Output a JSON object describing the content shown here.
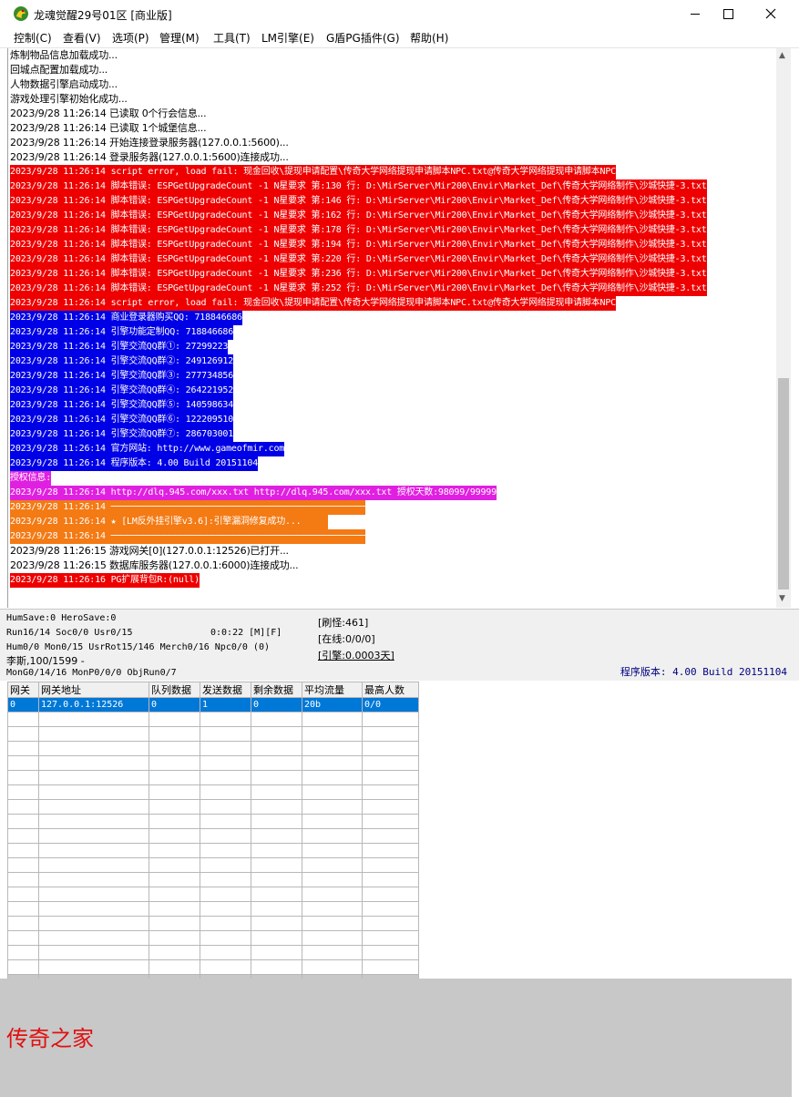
{
  "window": {
    "title": "龙魂觉醒29号01区 [商业版]",
    "icon": "dragon-app-icon",
    "controls": [
      "minimize-icon",
      "maximize-icon",
      "close-icon"
    ]
  },
  "menu": [
    {
      "label": "控制(C)"
    },
    {
      "label": "查看(V)"
    },
    {
      "label": "选项(P)"
    },
    {
      "label": "管理(M)"
    },
    {
      "label": "工具(T)"
    },
    {
      "label": "LM引擎(E)"
    },
    {
      "label": "G盾PG插件(G)"
    },
    {
      "label": "帮助(H)"
    }
  ],
  "colors": {
    "error": "#ee0000",
    "info": "#0000e6",
    "license": "#e020e0",
    "warning": "#f47a14",
    "selection": "#0078d7",
    "watermark": "#e01010"
  },
  "log": [
    {
      "text": "炼制物品信息加载成功...",
      "style": "black"
    },
    {
      "text": "回城点配置加载成功...",
      "style": "black"
    },
    {
      "text": "人物数据引擎启动成功...",
      "style": "black"
    },
    {
      "text": "游戏处理引擎初始化成功...",
      "style": "black"
    },
    {
      "text": "2023/9/28 11:26:14 已读取 0个行会信息...",
      "style": "black"
    },
    {
      "text": "2023/9/28 11:26:14 已读取 1个城堡信息...",
      "style": "black"
    },
    {
      "text": "2023/9/28 11:26:14 开始连接登录服务器(127.0.0.1:5600)...",
      "style": "black"
    },
    {
      "text": "2023/9/28 11:26:14 登录服务器(127.0.0.1:5600)连接成功...",
      "style": "black"
    },
    {
      "text": "2023/9/28 11:26:14 script error, load fail: 现金回收\\提现申请配置\\传奇大学网络提现申请脚本NPC.txt@传奇大学网络提现申请脚本NPC",
      "style": "red"
    },
    {
      "text": "2023/9/28 11:26:14 脚本错误: ESPGetUpgradeCount -1 N星要求 第:130 行: D:\\MirServer\\Mir200\\Envir\\Market_Def\\传奇大学网络制作\\沙城快捷-3.txt",
      "style": "red"
    },
    {
      "text": "2023/9/28 11:26:14 脚本错误: ESPGetUpgradeCount -1 N星要求 第:146 行: D:\\MirServer\\Mir200\\Envir\\Market_Def\\传奇大学网络制作\\沙城快捷-3.txt",
      "style": "red"
    },
    {
      "text": "2023/9/28 11:26:14 脚本错误: ESPGetUpgradeCount -1 N星要求 第:162 行: D:\\MirServer\\Mir200\\Envir\\Market_Def\\传奇大学网络制作\\沙城快捷-3.txt",
      "style": "red"
    },
    {
      "text": "2023/9/28 11:26:14 脚本错误: ESPGetUpgradeCount -1 N星要求 第:178 行: D:\\MirServer\\Mir200\\Envir\\Market_Def\\传奇大学网络制作\\沙城快捷-3.txt",
      "style": "red"
    },
    {
      "text": "2023/9/28 11:26:14 脚本错误: ESPGetUpgradeCount -1 N星要求 第:194 行: D:\\MirServer\\Mir200\\Envir\\Market_Def\\传奇大学网络制作\\沙城快捷-3.txt",
      "style": "red"
    },
    {
      "text": "2023/9/28 11:26:14 脚本错误: ESPGetUpgradeCount -1 N星要求 第:220 行: D:\\MirServer\\Mir200\\Envir\\Market_Def\\传奇大学网络制作\\沙城快捷-3.txt",
      "style": "red"
    },
    {
      "text": "2023/9/28 11:26:14 脚本错误: ESPGetUpgradeCount -1 N星要求 第:236 行: D:\\MirServer\\Mir200\\Envir\\Market_Def\\传奇大学网络制作\\沙城快捷-3.txt",
      "style": "red"
    },
    {
      "text": "2023/9/28 11:26:14 脚本错误: ESPGetUpgradeCount -1 N星要求 第:252 行: D:\\MirServer\\Mir200\\Envir\\Market_Def\\传奇大学网络制作\\沙城快捷-3.txt",
      "style": "red"
    },
    {
      "text": "2023/9/28 11:26:14 script error, load fail: 现金回收\\提现申请配置\\传奇大学网络提现申请脚本NPC.txt@传奇大学网络提现申请脚本NPC",
      "style": "red"
    },
    {
      "text": "2023/9/28 11:26:14 商业登录器购买QQ: 718846686",
      "style": "blue"
    },
    {
      "text": "2023/9/28 11:26:14 引擎功能定制QQ: 718846686",
      "style": "blue"
    },
    {
      "text": "2023/9/28 11:26:14 引擎交流QQ群①: 27299223",
      "style": "blue"
    },
    {
      "text": "2023/9/28 11:26:14 引擎交流QQ群②: 249126912",
      "style": "blue"
    },
    {
      "text": "2023/9/28 11:26:14 引擎交流QQ群③: 277734856",
      "style": "blue"
    },
    {
      "text": "2023/9/28 11:26:14 引擎交流QQ群④: 264221952",
      "style": "blue"
    },
    {
      "text": "2023/9/28 11:26:14 引擎交流QQ群⑤: 140598634",
      "style": "blue"
    },
    {
      "text": "2023/9/28 11:26:14 引擎交流QQ群⑥: 122209510",
      "style": "blue"
    },
    {
      "text": "2023/9/28 11:26:14 引擎交流QQ群⑦: 286703001",
      "style": "blue"
    },
    {
      "text": "2023/9/28 11:26:14 官方网站: http://www.gameofmir.com",
      "style": "blue"
    },
    {
      "text": "2023/9/28 11:26:14 程序版本: 4.00 Build 20151104",
      "style": "blue"
    },
    {
      "text": "授权信息:",
      "style": "magenta"
    },
    {
      "text": "2023/9/28 11:26:14 http://dlq.945.com/xxx.txt http://dlq.945.com/xxx.txt 授权天数:98099/99999",
      "style": "magenta"
    },
    {
      "text": "2023/9/28 11:26:14 ────────────────────────────────────────────────",
      "style": "orange"
    },
    {
      "text": "2023/9/28 11:26:14 ★ [LM反外挂引擎v3.6]:引擎漏洞修复成功...     ",
      "style": "orange"
    },
    {
      "text": "2023/9/28 11:26:14 ────────────────────────────────────────────────",
      "style": "orange"
    },
    {
      "text": "2023/9/28 11:26:15 游戏网关[0](127.0.0.1:12526)已打开...",
      "style": "black"
    },
    {
      "text": "2023/9/28 11:26:15 数据库服务器(127.0.0.1:6000)连接成功...",
      "style": "black"
    },
    {
      "text": "2023/9/28 11:26:16 PG扩展背包R:(null)",
      "style": "red"
    }
  ],
  "status": {
    "line1": "HumSave:0 HeroSave:0",
    "line2_left": "Run16/14 Soc0/0 Usr0/15",
    "line2_time": "0:0:22 [M][F]",
    "line3": "Hum0/0 Mon0/15 UsrRot15/146 Merch0/16 Npc0/0 (0)",
    "line4": "李斯,100/1599 -",
    "line5": "MonG0/14/16 MonP0/0/0 ObjRun0/7",
    "refresh": "[刷怪:461]",
    "online": "[在线:0/0/0]",
    "engine": "[引擎:0.0003天]",
    "program_version": "程序版本: 4.00 Build 20151104"
  },
  "gateway_table": {
    "columns": [
      "网关",
      "网关地址",
      "队列数据",
      "发送数据",
      "剩余数据",
      "平均流量",
      "最高人数"
    ],
    "rows": [
      [
        "0",
        "127.0.0.1:12526",
        "0",
        "1",
        "0",
        "20b",
        "0/0"
      ]
    ]
  },
  "watermark": "传奇之家"
}
